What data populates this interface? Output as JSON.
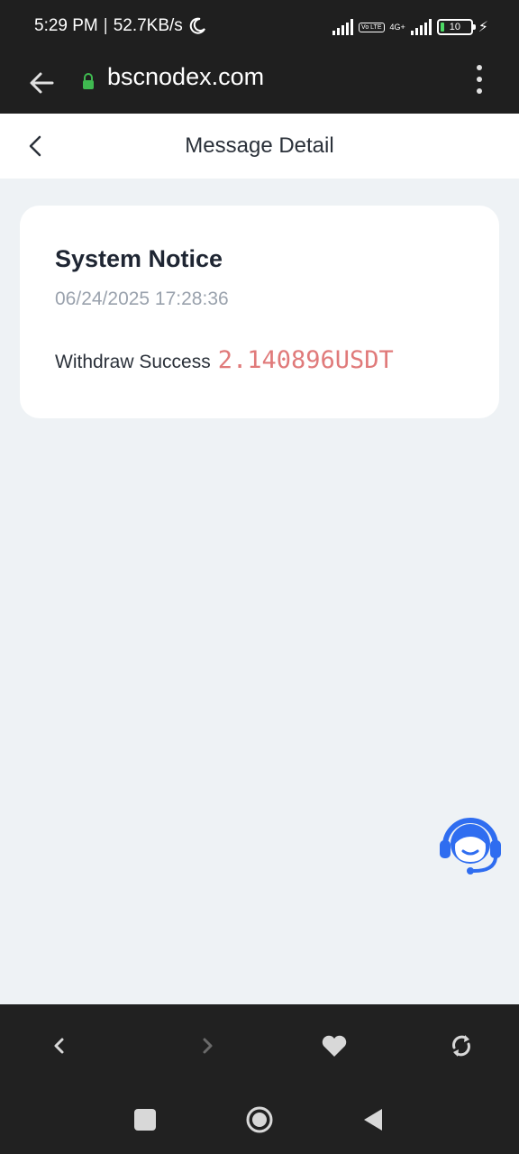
{
  "status_bar": {
    "time": "5:29 PM",
    "separator": "|",
    "net_speed": "52.7KB/s",
    "volte": "Vo LTE",
    "network": "4G+",
    "battery": "10",
    "icons": [
      "moon-icon",
      "signal-icon",
      "volte-icon",
      "battery-icon",
      "charging-icon"
    ]
  },
  "browser": {
    "url": "bscnodex.com",
    "icons": [
      "arrow-left-icon",
      "lock-icon",
      "more-vertical-icon"
    ],
    "lock_color": "#3fb950"
  },
  "header": {
    "title": "Message Detail"
  },
  "message": {
    "title": "System Notice",
    "timestamp": "06/24/2025 17:28:36",
    "label": "Withdraw Success",
    "amount": "2.140896USDT",
    "amount_color": "#e07a7a"
  },
  "support": {
    "icon": "customer-service-headset-icon",
    "color": "#2f6df0"
  },
  "browser_nav": {
    "icons": [
      "chevron-left-icon",
      "chevron-right-icon",
      "heart-icon",
      "refresh-icon"
    ]
  },
  "system_nav": {
    "icons": [
      "recents-square-icon",
      "home-circle-icon",
      "back-triangle-icon"
    ]
  }
}
